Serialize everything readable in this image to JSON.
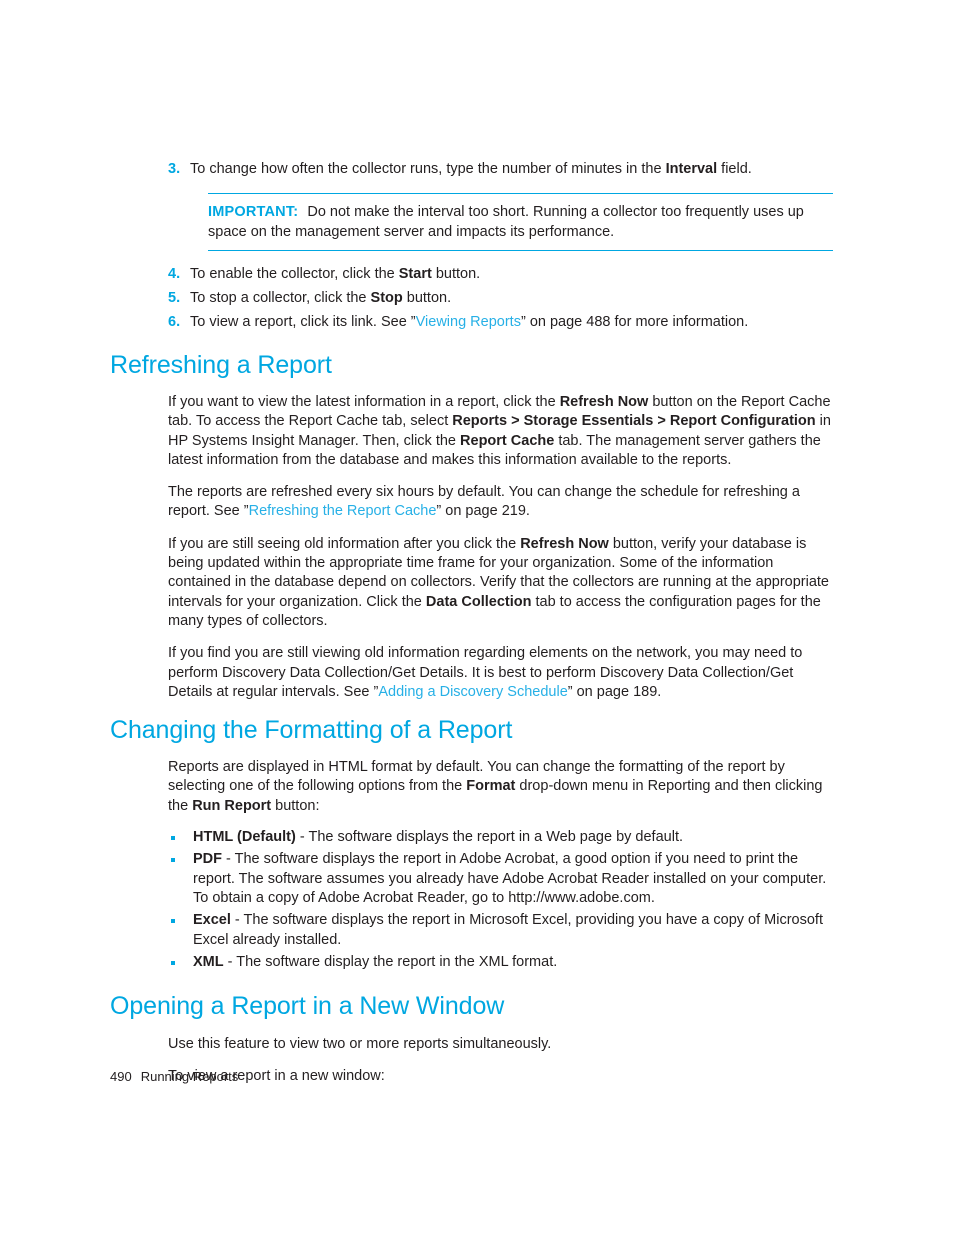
{
  "colors": {
    "accent": "#00a7e1",
    "link": "#27b0e6",
    "text": "#231f20"
  },
  "steps": [
    {
      "number": "3.",
      "parts": [
        {
          "t": "To change how often the collector runs, type the number of minutes in the "
        },
        {
          "t": "Interval",
          "style": "bold"
        },
        {
          "t": " field."
        }
      ],
      "text": "To change how often the collector runs, type the number of minutes in the Interval field."
    },
    {
      "number": "4.",
      "parts": [
        {
          "t": "To enable the collector, click the "
        },
        {
          "t": "Start",
          "style": "bold"
        },
        {
          "t": " button."
        }
      ],
      "text": "To enable the collector, click the Start button."
    },
    {
      "number": "5.",
      "parts": [
        {
          "t": "To stop a collector, click the "
        },
        {
          "t": "Stop",
          "style": "bold"
        },
        {
          "t": " button."
        }
      ],
      "text": "To stop a collector, click the Stop button."
    },
    {
      "number": "6.",
      "parts": [
        {
          "t": "To view a report, click its link. See “"
        },
        {
          "t": "Viewing Reports",
          "style": "link"
        },
        {
          "t": "” on page 488 for more information."
        }
      ],
      "text": "To view a report, click its link. See “Viewing Reports” on page 488 for more information."
    }
  ],
  "note": {
    "label": "IMPORTANT:",
    "text": "Do not make the interval too short. Running a collector too frequently uses up space on the management server and impacts its performance."
  },
  "sections": [
    {
      "heading": "Refreshing a Report",
      "paragraphs": [
        "If you want to view the latest information in a report, click the Refresh Now button on the Report Cache tab. To access the Report Cache tab, select Reports > Storage Essentials > Report Configuration in HP Systems Insight Manager. Then, click the Report Cache tab. The management server gathers the latest information from the database and makes this information available to the reports.",
        "The reports are refreshed every six hours by default. You can change the schedule for refreshing a report. See “Refreshing the Report Cache” on page 219.",
        "If you are still seeing old information after you click the Refresh Now button, verify your database is being updated within the appropriate time frame for your organization. Some of the information contained in the database depend on collectors. Verify that the collectors are running at the appropriate intervals for your organization. Click the Data Collection tab to access the configuration pages for the many types of collectors.",
        "If you find you are still viewing old information regarding elements on the network, you may need to perform Discovery Data Collection/Get Details. It is best to perform Discovery Data Collection/Get Details at regular intervals. See “Adding a Discovery Schedule” on page 189."
      ],
      "links": [
        "Refreshing the Report Cache",
        "Adding a Discovery Schedule"
      ]
    },
    {
      "heading": "Changing the Formatting of a Report",
      "paragraphs": [
        "Reports are displayed in HTML format by default. You can change the formatting of the report by selecting one of the following options from the Format drop-down menu in Reporting and then clicking the Run Report button:"
      ],
      "bullets": [
        {
          "term": "HTML (Default)",
          "body": " - The software displays the report in a Web page by default."
        },
        {
          "term": "PDF",
          "body": " - The software displays the report in Adobe Acrobat, a good option if you need to print the report. The software assumes you already have Adobe Acrobat Reader installed on your computer. To obtain a copy of Adobe Acrobat Reader, go to http://www.adobe.com."
        },
        {
          "term": "Excel",
          "body": " - The software displays the report in Microsoft Excel, providing you have a copy of Microsoft Excel already installed."
        },
        {
          "term": "XML",
          "body": " - The software display the report in the XML format."
        }
      ]
    },
    {
      "heading": "Opening a Report in a New Window",
      "paragraphs": [
        "Use this feature to view two or more reports simultaneously.",
        "To view a report in a new window:"
      ]
    }
  ],
  "footer": {
    "page_number": "490",
    "chapter": "Running Reports"
  }
}
